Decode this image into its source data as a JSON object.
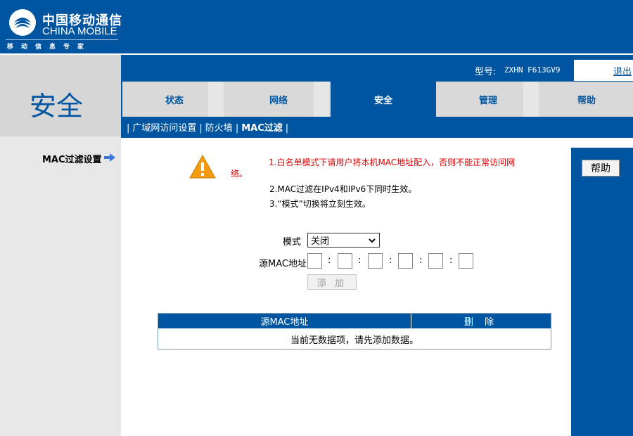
{
  "header": {
    "logo_cn": "中国移动通信",
    "logo_en": "CHINA MOBILE",
    "slogan": [
      "移",
      "动",
      "信",
      "息",
      "专",
      "家"
    ]
  },
  "page_title": "安全",
  "model": {
    "label": "型号:",
    "value": "ZXHN F613GV9"
  },
  "logout_label": "退出",
  "tabs": [
    {
      "label": "状态",
      "active": false
    },
    {
      "label": "网络",
      "active": false
    },
    {
      "label": "安全",
      "active": true
    },
    {
      "label": "管理",
      "active": false
    },
    {
      "label": "帮助",
      "active": false
    }
  ],
  "subnav": {
    "items": [
      "广域网访问设置",
      "防火墙",
      "MAC过滤"
    ],
    "current": "MAC过滤",
    "separator": "|"
  },
  "sidebar": {
    "item": "MAC过滤设置"
  },
  "notes": {
    "line1": "1.白名单模式下请用户将本机MAC地址配入，否则不能正常访问网",
    "line1_cont": "络。",
    "line2": "2.MAC过滤在IPv4和IPv6下同时生效。",
    "line3": "3.“模式”切换将立刻生效。"
  },
  "form": {
    "mode_label": "模式",
    "mode_value": "关闭",
    "mac_label": "源MAC地址",
    "mac_parts": [
      "",
      "",
      "",
      "",
      "",
      ""
    ],
    "separator": ":",
    "add_label": "添 加"
  },
  "table": {
    "col_mac": "源MAC地址",
    "col_delete": "删 除",
    "empty_text": "当前无数据项，请先添加数据。"
  },
  "help_button": "帮助",
  "colors": {
    "primary_blue": "#0055a0",
    "tab_gray": "#d9d9d9",
    "sidebar_gray": "#e7e7e7",
    "warning_red": "#e00000",
    "warning_icon": "#f39c12"
  }
}
